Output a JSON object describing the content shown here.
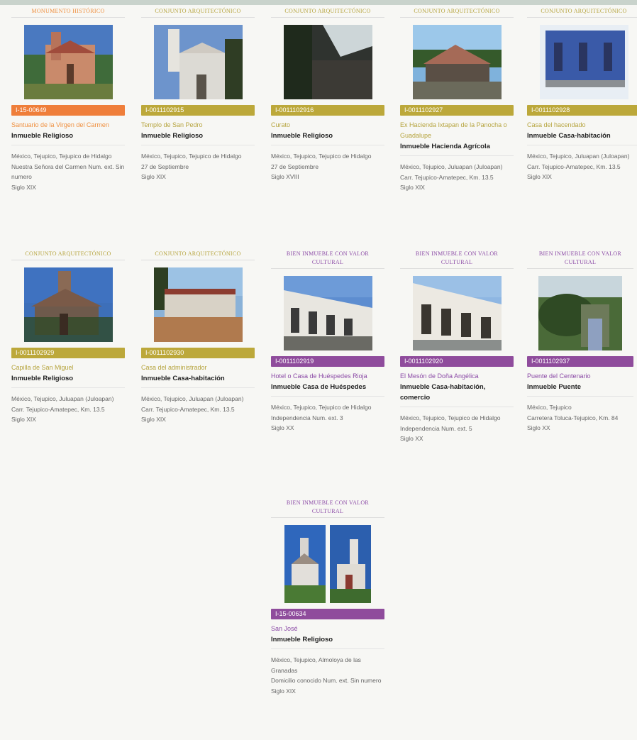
{
  "cards": [
    {
      "category": "MONUMENTO HISTÓRICO",
      "code": "I-15-00649",
      "name": "Santuario de la Virgen del Carmen",
      "type": "Inmueble Religioso",
      "location": "México, Tejupico, Tejupico de Hidalgo",
      "address": "Nuestra Señora del Carmen Num. ext. Sin numero",
      "extra": "",
      "century": "Siglo XIX"
    },
    {
      "category": "CONJUNTO ARQUITECTÓNICO",
      "code": "I-0011102915",
      "name": "Templo de San Pedro",
      "type": "Inmueble Religioso",
      "location": "México, Tejupico, Tejupico de Hidalgo",
      "address": "27 de Septiembre",
      "extra": "",
      "century": "Siglo XIX"
    },
    {
      "category": "CONJUNTO ARQUITECTÓNICO",
      "code": "I-0011102916",
      "name": "Curato",
      "type": "Inmueble Religioso",
      "location": "México, Tejupico, Tejupico de Hidalgo",
      "address": "27 de Septiembre",
      "extra": "",
      "century": "Siglo XVIII"
    },
    {
      "category": "CONJUNTO ARQUITECTÓNICO",
      "code": "I-0011102927",
      "name": "Ex Hacienda Ixtapan de la Panocha o Guadalupe",
      "type": "Inmueble Hacienda Agrícola",
      "location": "México, Tejupico, Juluapan (Juloapan)",
      "address": "Carr. Tejupico-Amatepec, Km. 13.5",
      "extra": "",
      "century": "Siglo XIX"
    },
    {
      "category": "CONJUNTO ARQUITECTÓNICO",
      "code": "I-0011102928",
      "name": "Casa del hacendado",
      "type": "Inmueble Casa-habitación",
      "location": "México, Tejupico, Juluapan (Juloapan)",
      "address": "Carr. Tejupico-Amatepec, Km. 13.5",
      "extra": "",
      "century": "Siglo XIX"
    },
    {
      "category": "CONJUNTO ARQUITECTÓNICO",
      "code": "I-0011102929",
      "name": "Capilla de San Miguel",
      "type": "Inmueble Religioso",
      "location": "México, Tejupico, Juluapan (Juloapan)",
      "address": "Carr. Tejupico-Amatepec, Km. 13.5",
      "extra": "",
      "century": "Siglo XIX"
    },
    {
      "category": "CONJUNTO ARQUITECTÓNICO",
      "code": "I-0011102930",
      "name": "Casa del administrador",
      "type": "Inmueble Casa-habitación",
      "location": "México, Tejupico, Juluapan (Juloapan)",
      "address": "Carr. Tejupico-Amatepec, Km. 13.5",
      "extra": "",
      "century": "Siglo XIX"
    },
    {
      "category": "BIEN INMUEBLE CON VALOR CULTURAL",
      "code": "I-0011102919",
      "name": "Hotel o Casa de Huéspedes Rioja",
      "type": "Inmueble Casa de Huéspedes",
      "location": "México, Tejupico, Tejupico de Hidalgo",
      "address": "Independencia Num. ext. 3",
      "extra": "",
      "century": "Siglo XX"
    },
    {
      "category": "BIEN INMUEBLE CON VALOR CULTURAL",
      "code": "I-0011102920",
      "name": "El Mesón de Doña Angélica",
      "type": "Inmueble Casa-habitación, comercio",
      "location": "México, Tejupico, Tejupico de Hidalgo",
      "address": "Independencia Num. ext. 5",
      "extra": "",
      "century": "Siglo XX"
    },
    {
      "category": "BIEN INMUEBLE CON VALOR CULTURAL",
      "code": "I-0011102937",
      "name": "Puente del Centenario",
      "type": "Inmueble Puente",
      "location": "México, Tejupico",
      "address": "Carretera Toluca-Tejupico, Km. 84",
      "extra": "",
      "century": "Siglo XX"
    },
    {
      "category": "BIEN INMUEBLE CON VALOR CULTURAL",
      "code": "I-15-00634",
      "name": "San José",
      "type": "Inmueble Religioso",
      "location": "México, Tejupico, Almoloya de las Granadas",
      "address": "Domicilio conocido Num. ext. Sin numero",
      "extra": "",
      "century": "Siglo XIX"
    }
  ]
}
